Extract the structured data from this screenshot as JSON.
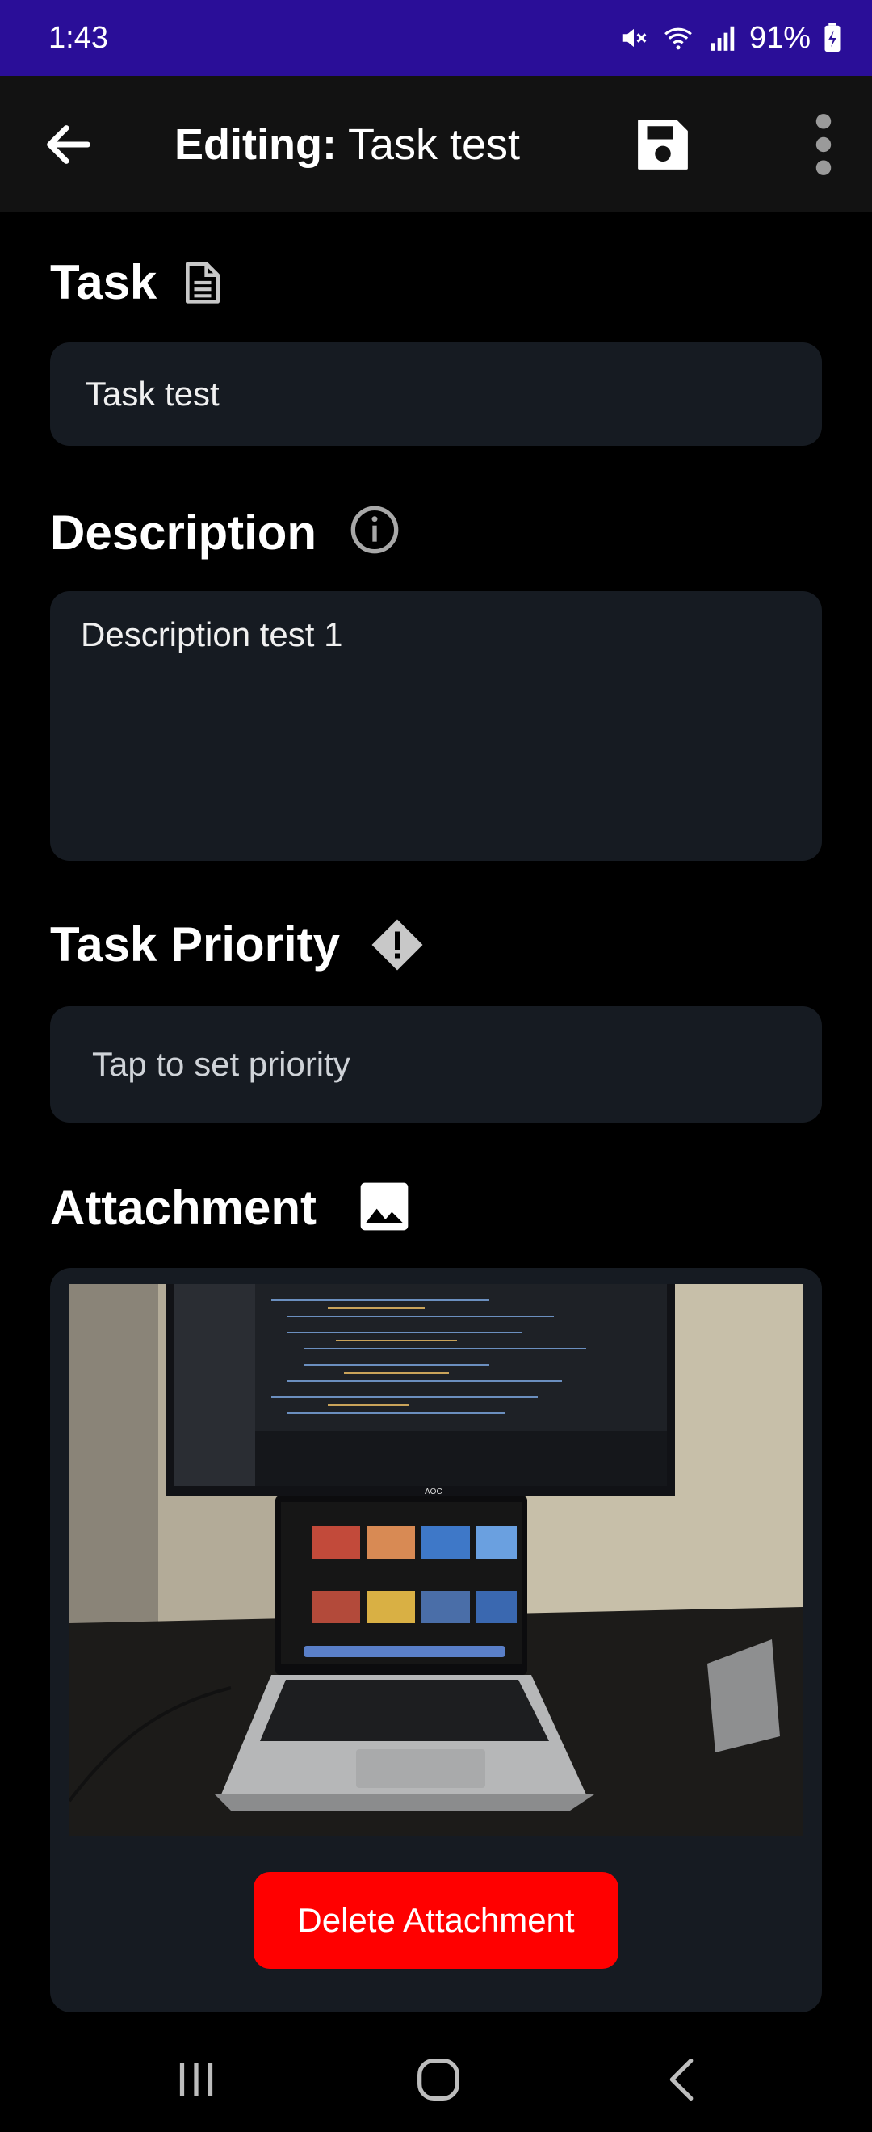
{
  "status_bar": {
    "time": "1:43",
    "battery": "91%"
  },
  "app_bar": {
    "title_prefix": "Editing:",
    "title_name": "Task test"
  },
  "task": {
    "label": "Task",
    "value": "Task test"
  },
  "description": {
    "label": "Description",
    "value": "Description test 1"
  },
  "priority": {
    "label": "Task Priority",
    "placeholder": "Tap to set priority"
  },
  "attachment": {
    "label": "Attachment",
    "delete_label": "Delete Attachment",
    "photo_brand": "AOC"
  },
  "icons": {
    "back": "back-arrow-icon",
    "save": "save-icon",
    "more": "more-vert-icon",
    "task": "document-icon",
    "description": "info-icon",
    "priority": "priority-diamond-icon",
    "attachment": "image-icon"
  },
  "colors": {
    "status_bar": "#2a0e98",
    "field_bg": "#161b22",
    "delete_button": "#ff0000"
  }
}
